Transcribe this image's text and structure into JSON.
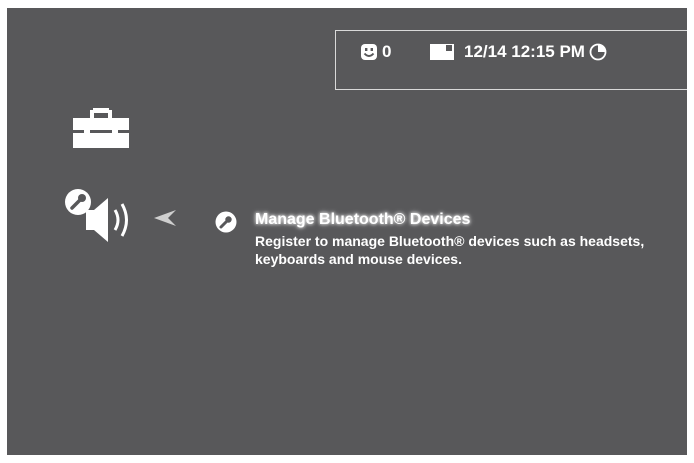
{
  "status": {
    "friends_online": "0",
    "datetime": "12/14 12:15 PM"
  },
  "icons": {
    "toolbox": "toolbox-icon",
    "settings_speaker": "wrench-speaker-icon",
    "back_arrow": "left-arrow-icon",
    "item": "wrench-icon",
    "friends": "smiley-icon",
    "messages": "message-icon",
    "clock": "clock-icon"
  },
  "colors": {
    "background": "#58585a",
    "text": "#ffffff"
  },
  "menu": {
    "selected_item": {
      "title": "Manage Bluetooth® Devices",
      "description": "Register to manage Bluetooth® devices such as headsets, keyboards and mouse devices."
    }
  }
}
